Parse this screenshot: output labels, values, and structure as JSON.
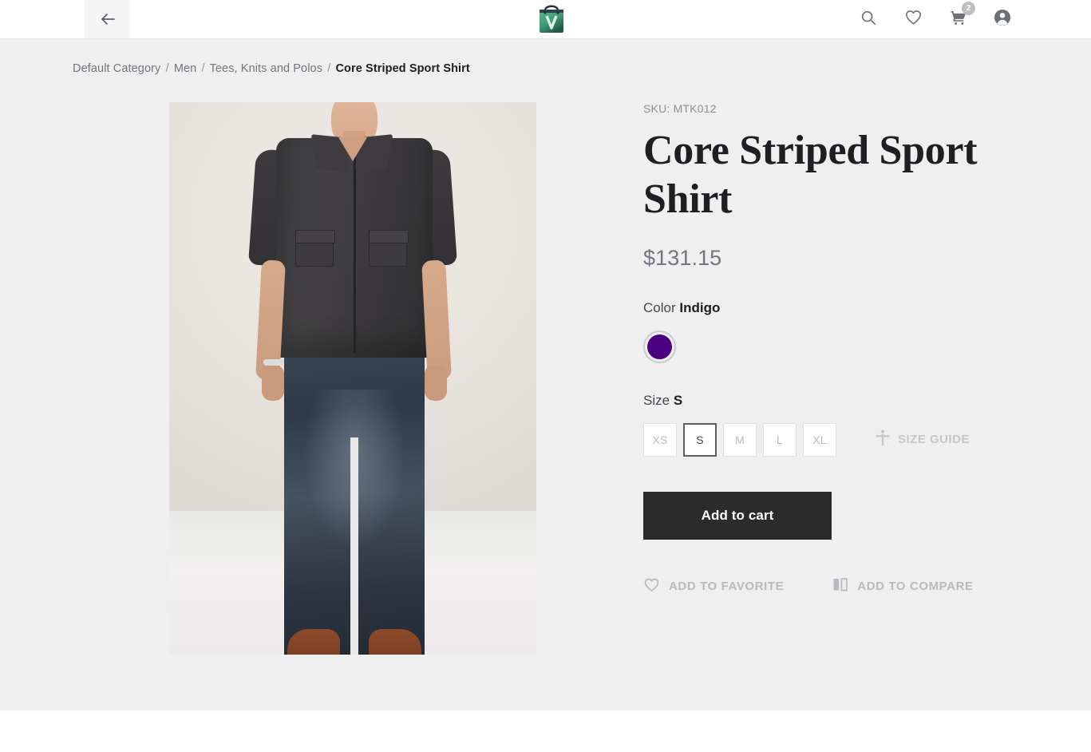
{
  "header": {
    "back_icon": "arrow-left-icon",
    "logo_alt": "shopping-bag-logo",
    "actions": [
      {
        "name": "search-icon",
        "label": "Search"
      },
      {
        "name": "heart-icon",
        "label": "Wishlist"
      },
      {
        "name": "cart-icon",
        "label": "Cart",
        "badge": "2"
      },
      {
        "name": "account-icon",
        "label": "Account"
      }
    ]
  },
  "breadcrumb": {
    "items": [
      {
        "label": "Default Category",
        "current": false
      },
      {
        "label": "Men",
        "current": false
      },
      {
        "label": "Tees, Knits and Polos",
        "current": false
      },
      {
        "label": "Core Striped Sport Shirt",
        "current": true
      }
    ],
    "separator": "/"
  },
  "product": {
    "sku_label": "SKU: MTK012",
    "title": "Core Striped Sport Shirt",
    "price": "$131.15",
    "color_label": "Color",
    "color_value": "Indigo",
    "color_hex": "#4b0080",
    "size_label": "Size",
    "size_value": "S",
    "sizes": [
      "XS",
      "S",
      "M",
      "L",
      "XL"
    ],
    "selected_size": "S",
    "size_guide_label": "SIZE GUIDE",
    "size_guide_icon": "person-icon",
    "add_to_cart_label": "Add to cart",
    "favorite_label": "ADD TO FAVORITE",
    "favorite_icon": "heart-icon",
    "compare_label": "ADD TO COMPARE",
    "compare_icon": "compare-icon",
    "image_alt": "Man wearing dark charcoal short sleeve sport shirt with jeans and brown loafers"
  },
  "colors": {
    "page_background": "#efefef",
    "header_background": "#ffffff",
    "accent_dark": "#2b2b2b",
    "muted_text": "#72757e",
    "logo_green": "#3b8d6f"
  }
}
